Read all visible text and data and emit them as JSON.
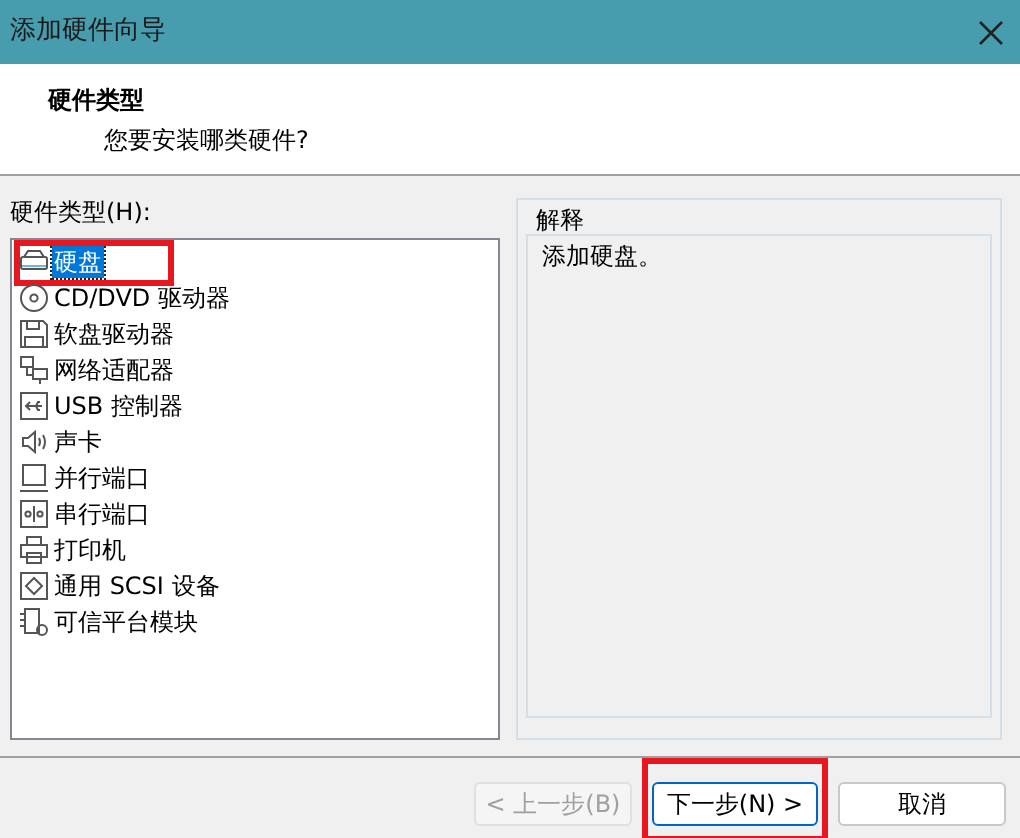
{
  "window": {
    "title": "添加硬件向导"
  },
  "header": {
    "title": "硬件类型",
    "subtitle": "您要安装哪类硬件?"
  },
  "hardware_list": {
    "label": "硬件类型(H):",
    "items": [
      {
        "kind": "disk",
        "label": "硬盘",
        "selected": true,
        "highlighted": true
      },
      {
        "kind": "cd",
        "label": "CD/DVD 驱动器",
        "selected": false,
        "highlighted": false
      },
      {
        "kind": "floppy",
        "label": "软盘驱动器",
        "selected": false,
        "highlighted": false
      },
      {
        "kind": "network",
        "label": "网络适配器",
        "selected": false,
        "highlighted": false
      },
      {
        "kind": "usb",
        "label": "USB 控制器",
        "selected": false,
        "highlighted": false
      },
      {
        "kind": "sound",
        "label": "声卡",
        "selected": false,
        "highlighted": false
      },
      {
        "kind": "parallel",
        "label": "并行端口",
        "selected": false,
        "highlighted": false
      },
      {
        "kind": "serial",
        "label": "串行端口",
        "selected": false,
        "highlighted": false
      },
      {
        "kind": "printer",
        "label": "打印机",
        "selected": false,
        "highlighted": false
      },
      {
        "kind": "scsi",
        "label": "通用 SCSI 设备",
        "selected": false,
        "highlighted": false
      },
      {
        "kind": "tpm",
        "label": "可信平台模块",
        "selected": false,
        "highlighted": false
      }
    ]
  },
  "explanation": {
    "title": "解释",
    "text": "添加硬盘。"
  },
  "buttons": [
    {
      "label": "< 上一步(B)",
      "disabled": true,
      "highlighted": false
    },
    {
      "label": "下一步(N) >",
      "disabled": false,
      "highlighted": true
    },
    {
      "label": "取消",
      "disabled": false,
      "highlighted": false
    }
  ]
}
